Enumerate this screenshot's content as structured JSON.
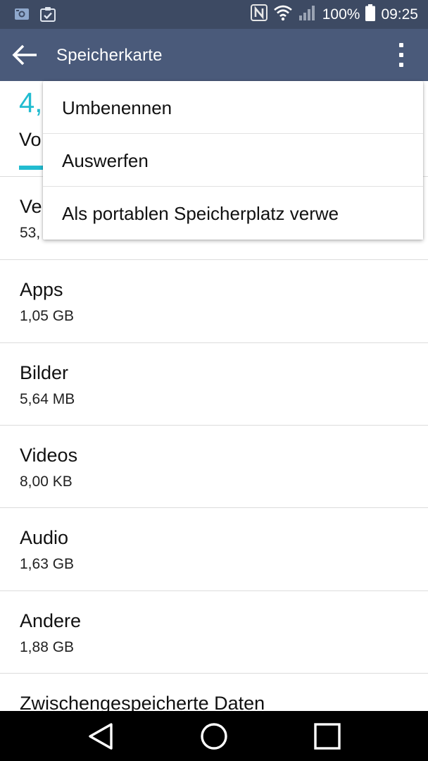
{
  "status_bar": {
    "left_icons": [
      "camera-notification-icon",
      "clipboard-check-icon"
    ],
    "right_icons": [
      "nfc-icon",
      "wifi-icon",
      "cellular-signal-icon",
      "battery-icon"
    ],
    "battery_percent": "100%",
    "time": "09:25",
    "colors": {
      "background": "#3d4a63"
    }
  },
  "toolbar": {
    "title": "Speicherkarte",
    "back_icon": "arrow-left-icon",
    "overflow_icon": "more-vertical-icon",
    "colors": {
      "background": "#4a5a7a"
    }
  },
  "summary": {
    "amount_visible": "4,",
    "label_visible": "Vo",
    "accent_color": "#22bcd0"
  },
  "partially_hidden_row": {
    "title_visible": "Ve",
    "value_visible": "53,"
  },
  "menu": {
    "items": [
      {
        "label": "Umbenennen"
      },
      {
        "label": "Auswerfen"
      },
      {
        "label": "Als portablen Speicherplatz verwe"
      }
    ]
  },
  "storage_items": [
    {
      "title": "Apps",
      "size": "1,05 GB"
    },
    {
      "title": "Bilder",
      "size": "5,64 MB"
    },
    {
      "title": "Videos",
      "size": "8,00 KB"
    },
    {
      "title": "Audio",
      "size": "1,63 GB"
    },
    {
      "title": "Andere",
      "size": "1,88 GB"
    },
    {
      "title": "Zwischengespeicherte Daten",
      "size": ""
    }
  ],
  "nav_bar": {
    "buttons": [
      "back-triangle-icon",
      "home-circle-icon",
      "recents-square-icon"
    ]
  }
}
